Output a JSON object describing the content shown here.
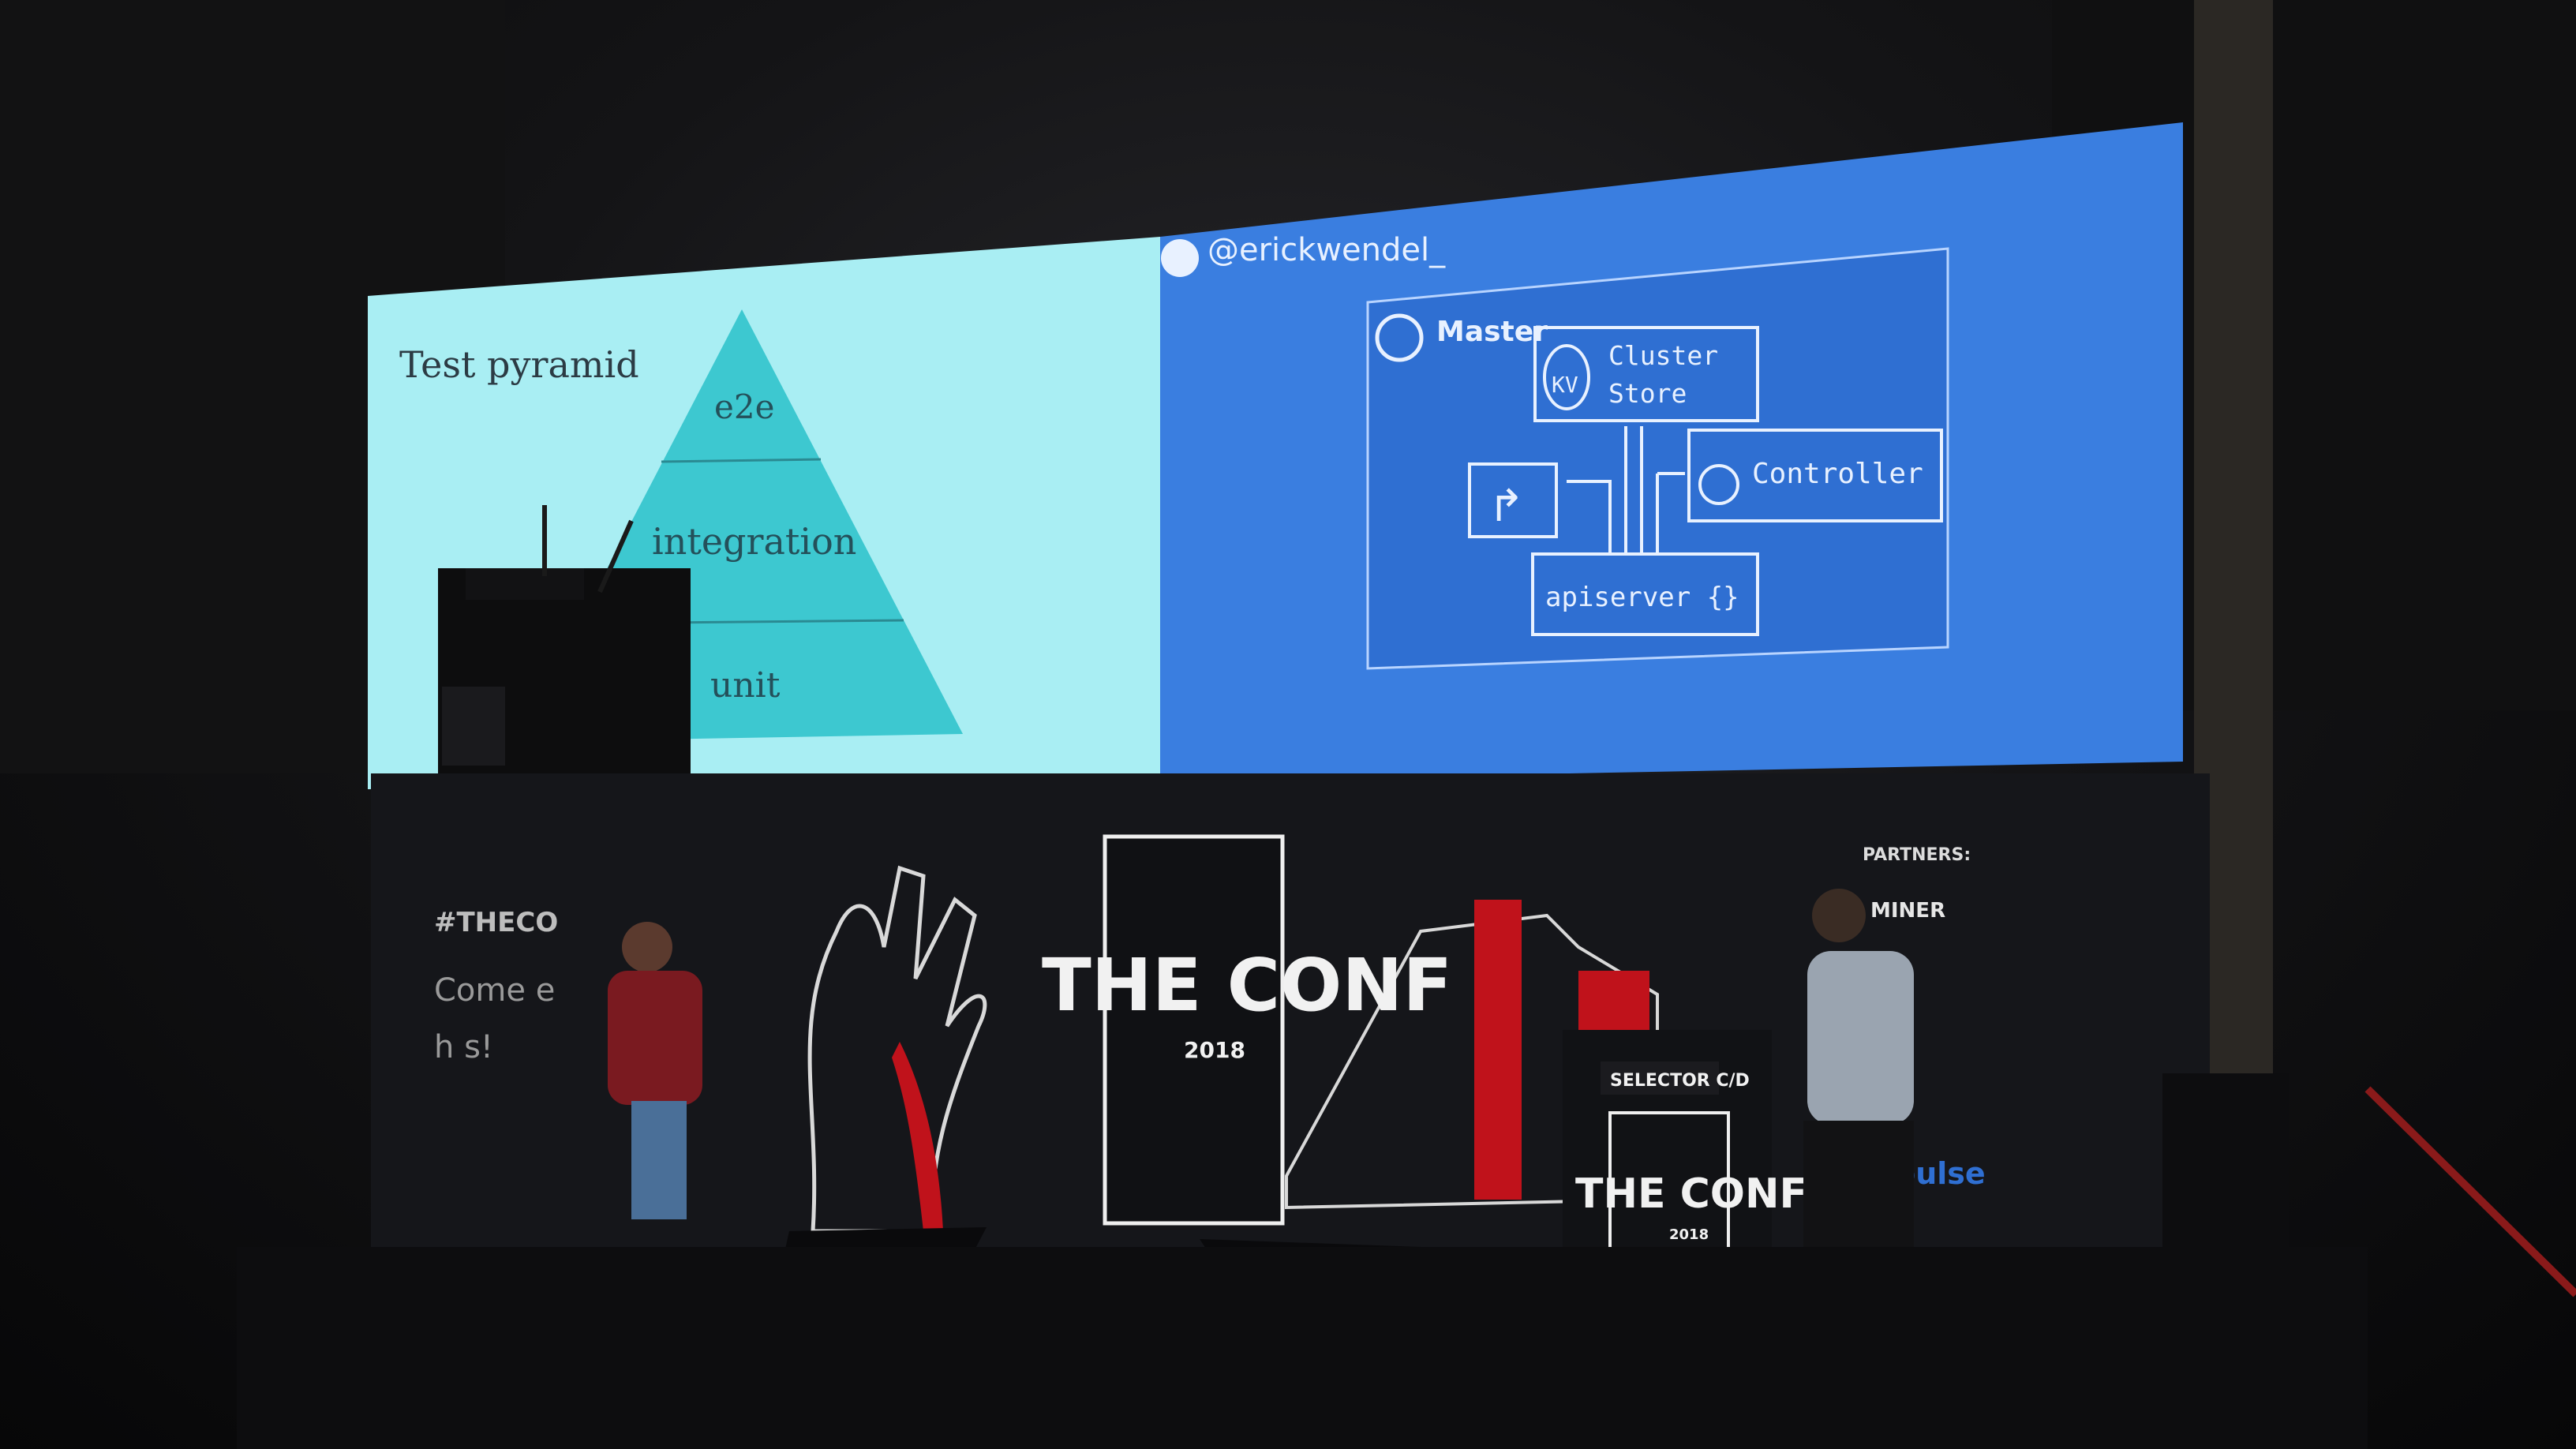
{
  "slide_left": {
    "title": "Test pyramid",
    "levels": [
      "e2e",
      "integration",
      "unit"
    ]
  },
  "slide_right": {
    "handle": "@erickwendel_",
    "diagram": {
      "master_label": "Master",
      "kv_label": "KV",
      "cluster_store": [
        "Cluster",
        "Store"
      ],
      "controller": "Controller",
      "apiserver": "apiserver {}"
    }
  },
  "stage": {
    "logo_main": "THE CONF",
    "logo_year": "2018",
    "podium_sign": "SELECTOR C/D",
    "podium_logo": "THE CONF",
    "podium_year": "2018",
    "partners_label": "PARTNERS:",
    "partner_miner": "MINER",
    "partner_pulse": "pulse",
    "hashtag": "#THECO",
    "slogan_line1": "Come e",
    "slogan_line2": "h         s!"
  },
  "colors": {
    "slide_left_bg": "#a9eef3",
    "pyramid": "#3dc8d0",
    "slide_right_bg": "#3a7ee0",
    "diagram_box": "#2f6fd2",
    "accent_red": "#c0121b"
  }
}
